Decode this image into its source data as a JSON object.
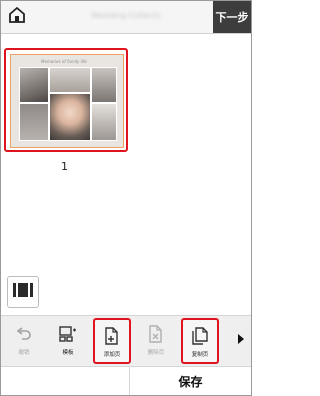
{
  "topbar": {
    "title": "Wedding Collection Album",
    "next_label": "下一步"
  },
  "page": {
    "collage_title": "Memories of family life",
    "number": "1"
  },
  "toolbar": {
    "undo_label": "撤销",
    "template_label": "模板",
    "add_page_label": "添加页",
    "delete_page_label": "删除页",
    "copy_page_label": "复制页"
  },
  "bottom": {
    "save_label": "保存"
  },
  "colors": {
    "highlight": "#e0141e",
    "next_button_bg": "#3d3d3d",
    "toolbar_bg": "#efefef"
  }
}
